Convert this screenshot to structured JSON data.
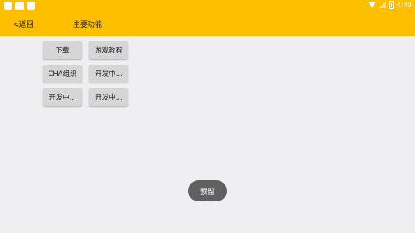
{
  "status_bar": {
    "time": "4:48",
    "icons": [
      "notification-icon",
      "notification-icon",
      "notification-icon",
      "wifi-icon",
      "signal-icon",
      "battery-icon"
    ]
  },
  "header": {
    "back_label": "<返回",
    "title": "主要功能",
    "background_color": "#fdbf00"
  },
  "buttons": [
    {
      "label": "下载"
    },
    {
      "label": "游戏教程"
    },
    {
      "label": "CHA组织"
    },
    {
      "label": "开发中..."
    },
    {
      "label": "开发中..."
    },
    {
      "label": "开发中..."
    }
  ],
  "toast": {
    "label": "预留"
  }
}
